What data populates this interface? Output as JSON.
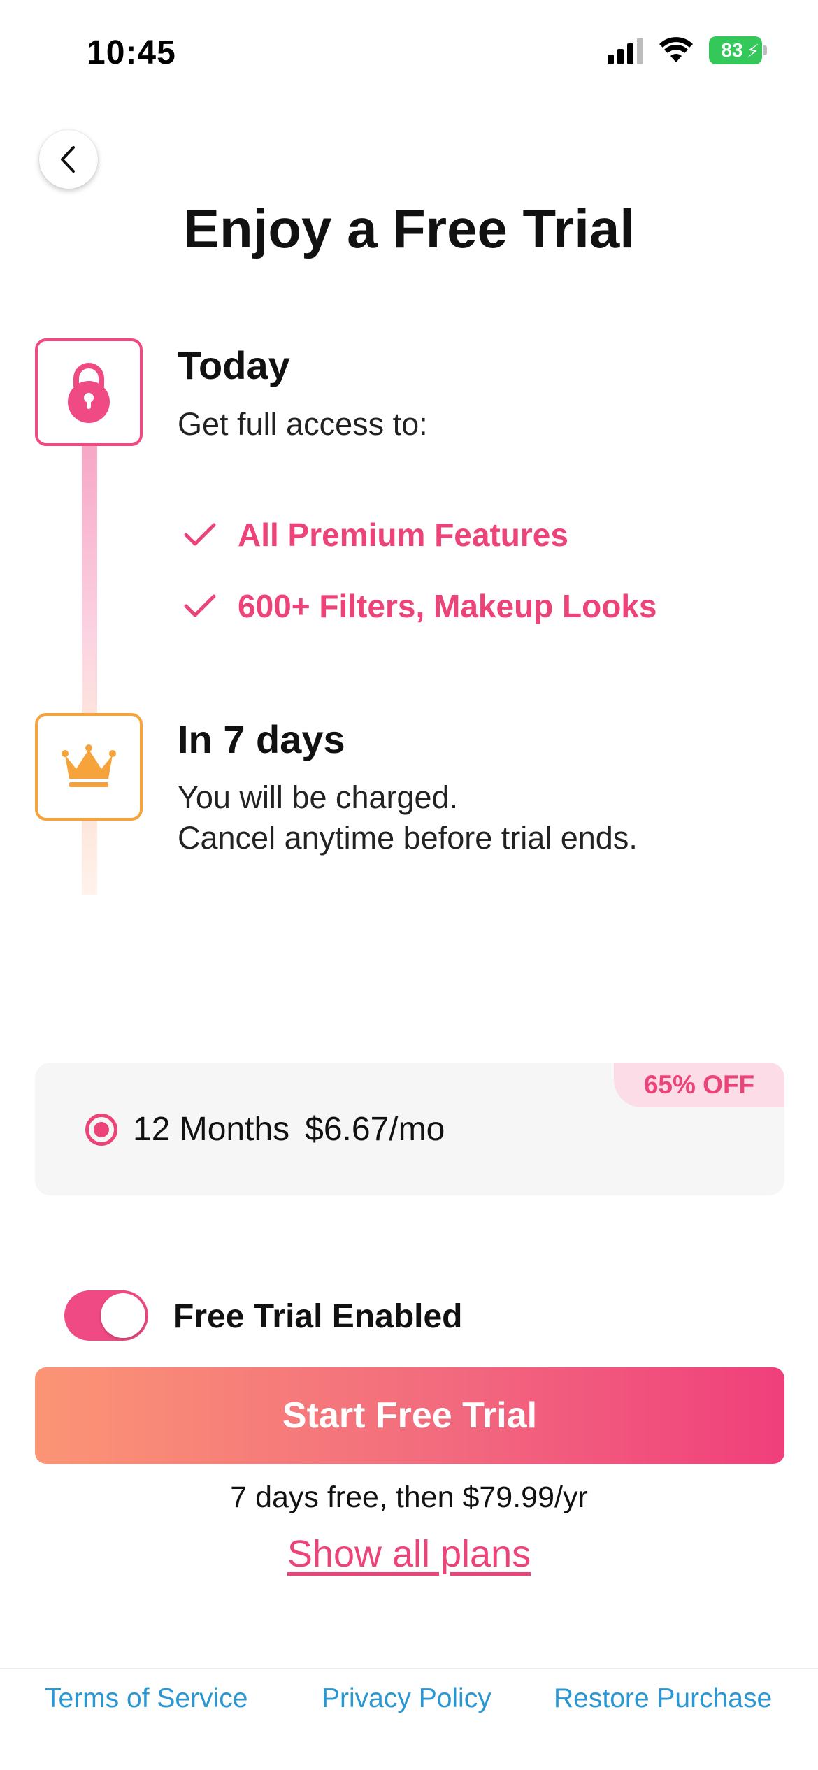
{
  "status_bar": {
    "time": "10:45",
    "battery": "83"
  },
  "header": {
    "title": "Enjoy a Free Trial"
  },
  "timeline": {
    "today": {
      "title": "Today",
      "subtitle": "Get full access to:",
      "features": [
        "All Premium Features",
        "600+ Filters, Makeup Looks"
      ]
    },
    "later": {
      "title": "In 7 days",
      "line1": "You will be charged.",
      "line2": "Cancel anytime before trial ends."
    }
  },
  "plan": {
    "badge": "65% OFF",
    "duration": "12 Months",
    "price": "$6.67/mo",
    "selected": true
  },
  "trial_toggle": {
    "label": "Free Trial Enabled",
    "enabled": true
  },
  "cta": {
    "label": "Start Free Trial"
  },
  "price_note": "7 days free, then $79.99/yr",
  "show_plans": "Show all plans",
  "footer": {
    "terms": "Terms of Service",
    "privacy": "Privacy Policy",
    "restore": "Restore Purchase"
  },
  "colors": {
    "accent": "#ec4379",
    "crown": "#f6a33c",
    "link": "#2a96d2"
  }
}
